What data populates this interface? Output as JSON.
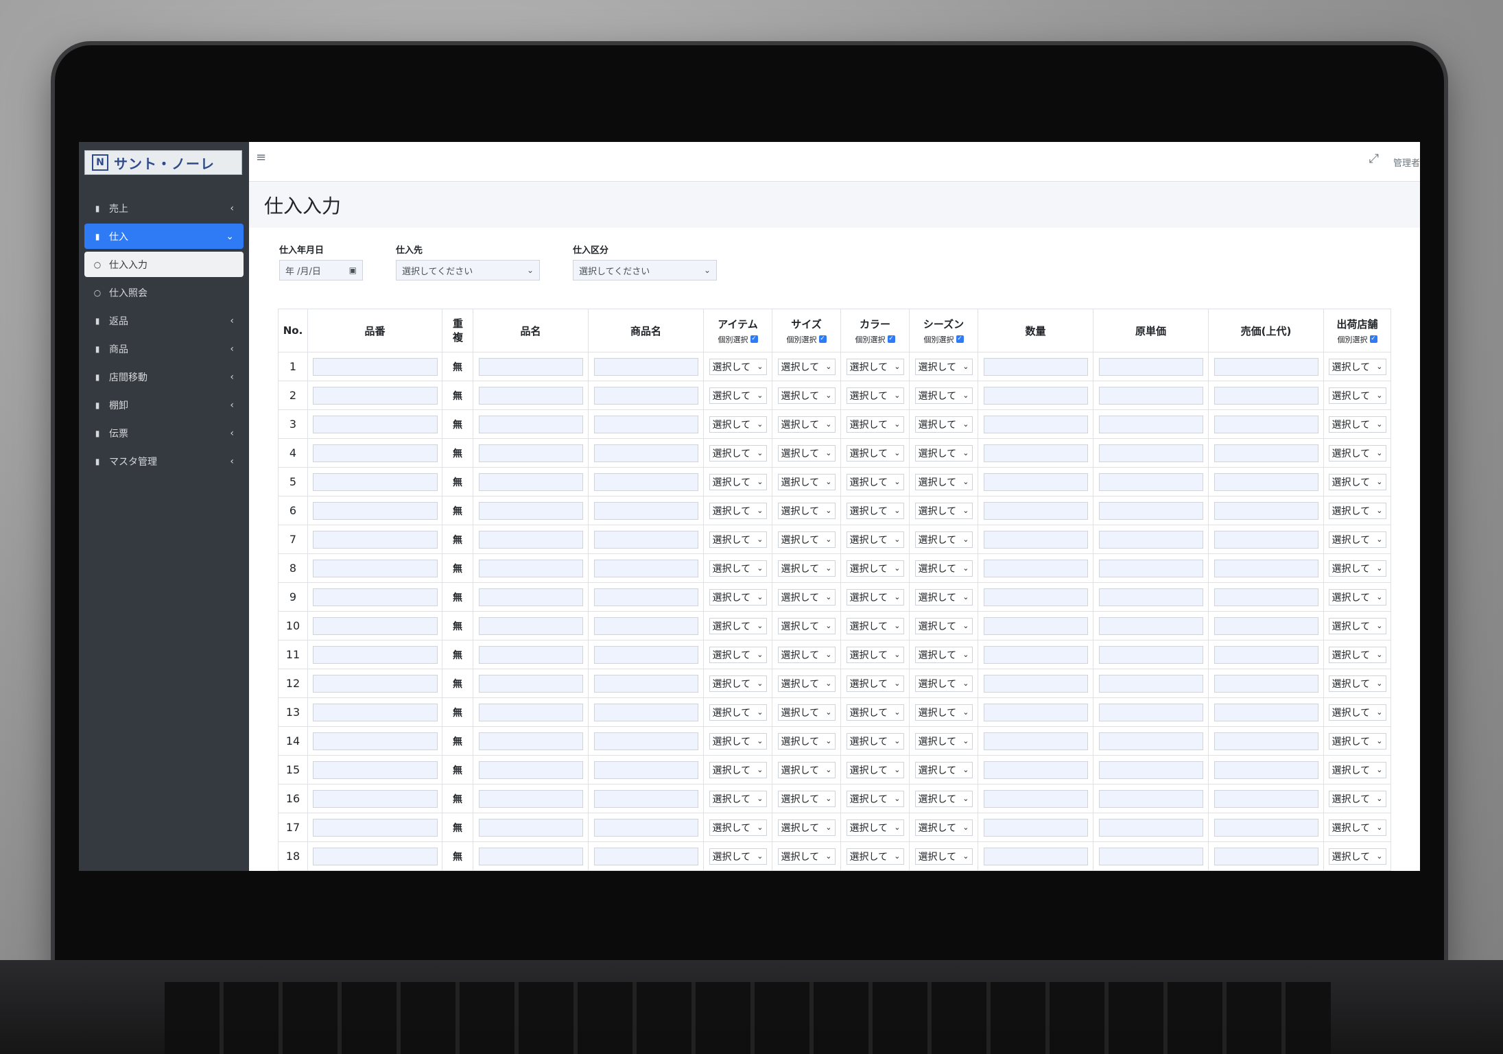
{
  "logo": {
    "mark": "N",
    "text": "サント・ノーレ"
  },
  "sidebar": {
    "items": [
      {
        "label": "売上",
        "chev": "‹"
      },
      {
        "label": "仕入",
        "chev": "⌄"
      },
      {
        "label": "仕入入力",
        "chev": ""
      },
      {
        "label": "仕入照会",
        "chev": ""
      },
      {
        "label": "返品",
        "chev": "‹"
      },
      {
        "label": "商品",
        "chev": "‹"
      },
      {
        "label": "店間移動",
        "chev": "‹"
      },
      {
        "label": "棚卸",
        "chev": "‹"
      },
      {
        "label": "伝票",
        "chev": "‹"
      },
      {
        "label": "マスタ管理",
        "chev": "‹"
      }
    ]
  },
  "header": {
    "user": "管理者"
  },
  "page": {
    "title": "仕入入力"
  },
  "filters": {
    "date": {
      "label": "仕入年月日",
      "value": "年 /月/日"
    },
    "supplier": {
      "label": "仕入先",
      "value": "選択してください"
    },
    "category": {
      "label": "仕入区分",
      "value": "選択してください"
    }
  },
  "table": {
    "headers": {
      "no": "No.",
      "part_no": "品番",
      "dup": "重複",
      "item_name": "品名",
      "product_name": "商品名",
      "item": "アイテム",
      "size": "サイズ",
      "color": "カラー",
      "season": "シーズン",
      "qty": "数量",
      "unit_cost": "原単価",
      "price": "売価(上代)",
      "store": "出荷店舗",
      "individual": "個別選択"
    },
    "dup_value": "無",
    "select_value": "選択して",
    "rows": [
      "1",
      "2",
      "3",
      "4",
      "5",
      "6",
      "7",
      "8",
      "9",
      "10",
      "11",
      "12",
      "13",
      "14",
      "15",
      "16",
      "17",
      "18"
    ]
  }
}
